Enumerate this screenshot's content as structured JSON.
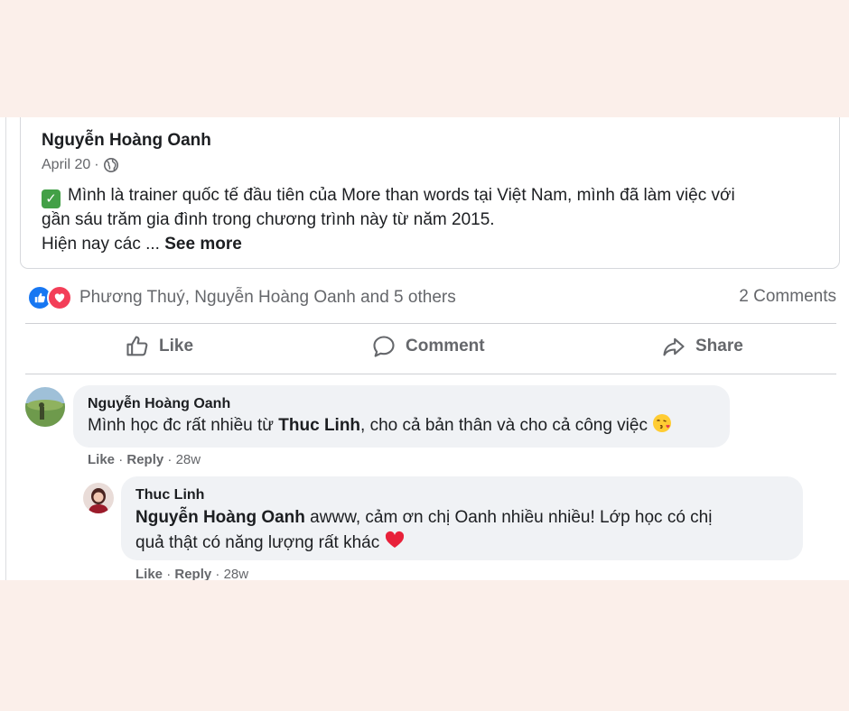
{
  "post": {
    "author": "Nguyễn Hoàng Oanh",
    "date": "April 20",
    "dot": "·",
    "globe_icon": "globe-icon",
    "check_icon": "green-checkmark-emoji",
    "text_line1": "Mình là trainer quốc tế đầu tiên của More than words tại Việt Nam, mình đã làm việc với",
    "text_line2": "gần sáu trăm gia đình trong chương trình này từ năm 2015.",
    "text_line3": "Hiện nay các ...",
    "see_more": "See more"
  },
  "stats": {
    "reaction_icons": [
      "like-reaction-icon",
      "love-reaction-icon"
    ],
    "reactors": "Phương Thuý, Nguyễn Hoàng Oanh and 5 others",
    "comments": "2 Comments"
  },
  "actions": {
    "like": "Like",
    "comment": "Comment",
    "share": "Share"
  },
  "comments": [
    {
      "author": "Nguyễn Hoàng Oanh",
      "text_before": "Mình học đc rất nhiều từ ",
      "mention": "Thuc Linh",
      "text_after": ", cho cả bản thân và cho cả công việc",
      "emoji": "face-blowing-kiss-emoji",
      "like": "Like",
      "reply": "Reply",
      "sep": "·",
      "time": "28w"
    },
    {
      "author": "Thuc Linh",
      "mention": "Nguyễn Hoàng Oanh",
      "text_line1": " awww, cảm ơn chị Oanh nhiều nhiều! Lớp học có chị",
      "text_line2": "quả thật có năng lượng rất khác",
      "emoji": "red-heart-emoji",
      "like": "Like",
      "reply": "Reply",
      "sep": "·",
      "time": "28w"
    }
  ],
  "colors": {
    "page_background": "#fbefea",
    "card_background": "#ffffff",
    "bubble": "#f0f2f5",
    "secondary_text": "#65676b",
    "like_blue": "#1877f2",
    "love_red": "#f33e58"
  }
}
